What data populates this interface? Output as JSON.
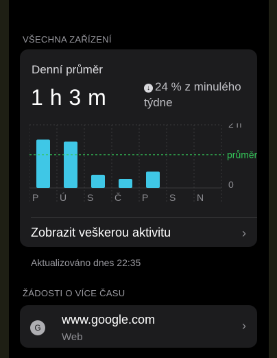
{
  "section_all_devices": "VŠECHNA ZAŘÍZENÍ",
  "daily": {
    "label": "Denní průměr",
    "value": "1 h 3 m",
    "change_text": "24 % z minulého týdne",
    "change_icon": "arrow-down-circle-icon"
  },
  "chart_data": {
    "type": "bar",
    "categories": [
      "P",
      "Ú",
      "S",
      "Č",
      "P",
      "S",
      "N"
    ],
    "values": [
      92,
      88,
      25,
      17,
      31,
      0,
      0
    ],
    "y_unit": "minutes",
    "ylim": [
      0,
      120
    ],
    "y_tick_labels": [
      "2 h",
      "0"
    ],
    "average_label": "průměr",
    "average_value": 63,
    "colors": {
      "bar": "#3fc7e6",
      "average": "#34c759",
      "grid": "#3a3a3c"
    }
  },
  "show_all_activity": "Zobrazit veškerou aktivitu",
  "updated_text": "Aktualizováno dnes 22:35",
  "section_requests": "ŽÁDOSTI O VÍCE ČASU",
  "request": {
    "icon_letter": "G",
    "title": "www.google.com",
    "subtitle": "Web"
  }
}
